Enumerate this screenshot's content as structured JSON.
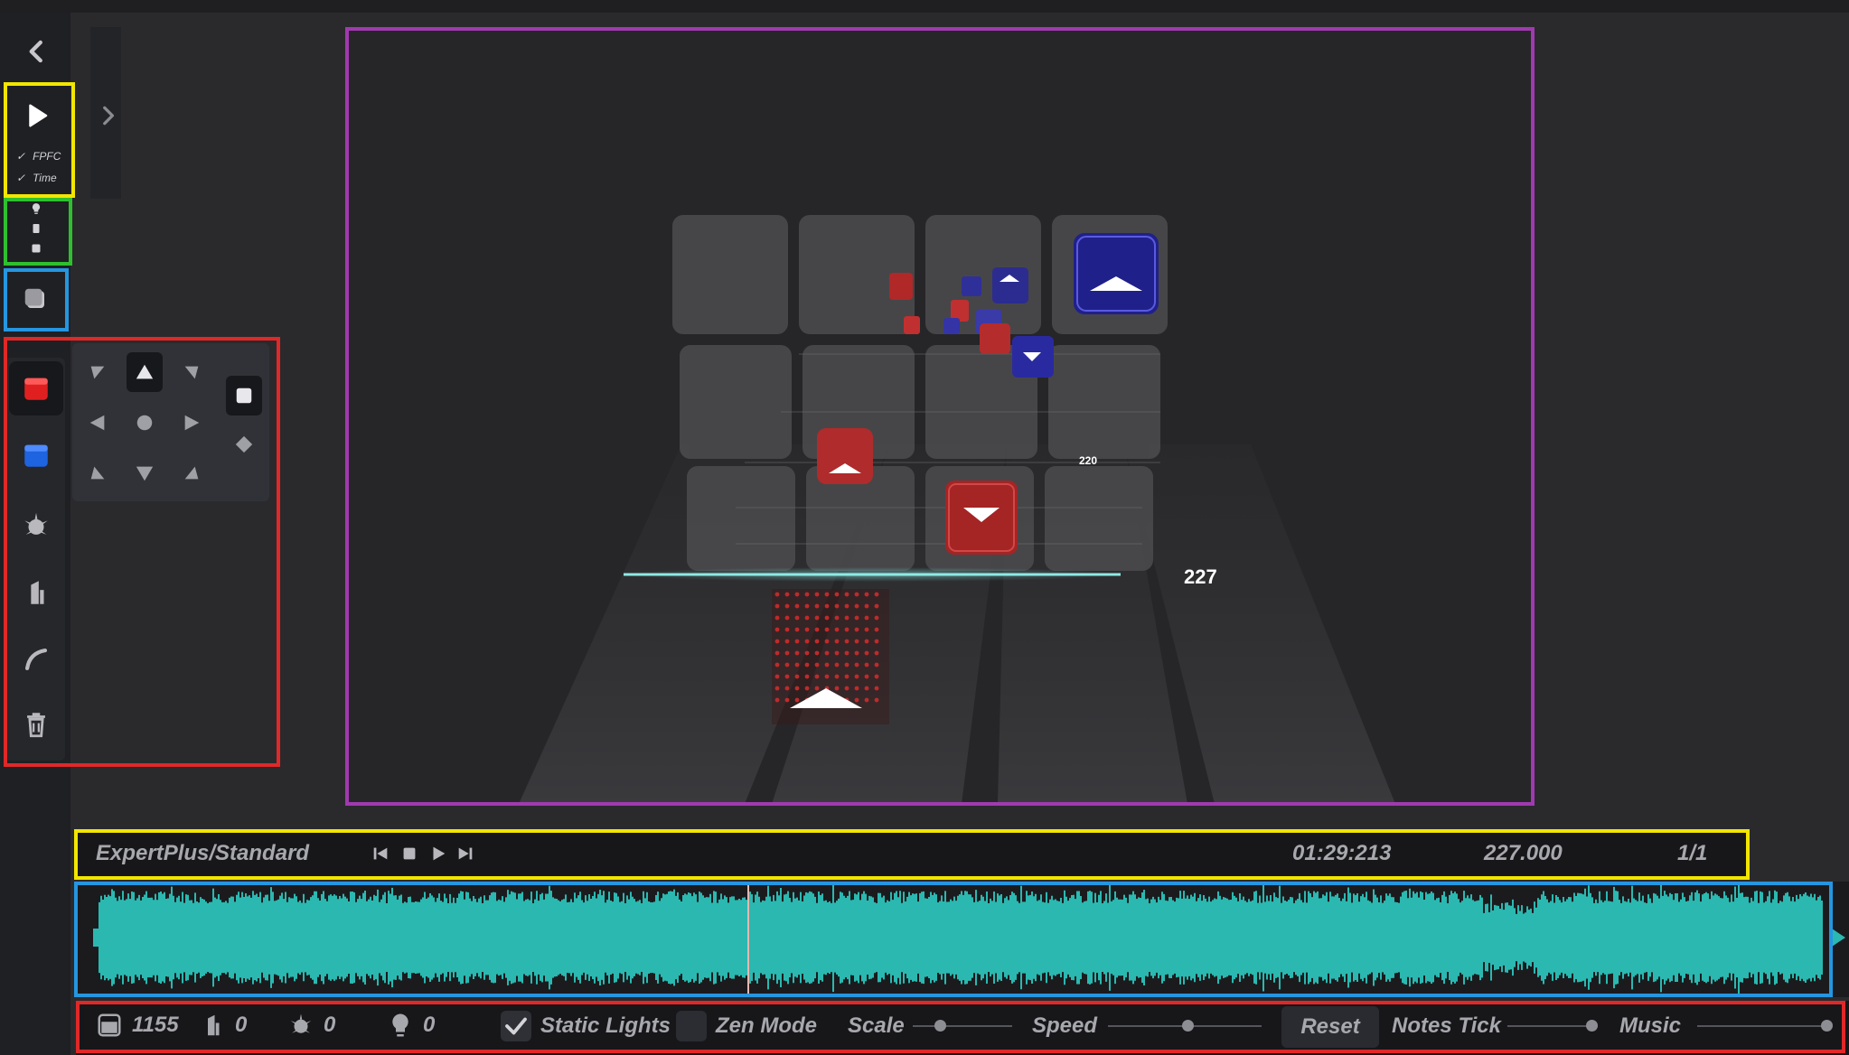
{
  "app": {
    "difficulty": "ExpertPlus/Standard",
    "time": "01:29:213",
    "beat": "227.000",
    "subdivision": "1/1"
  },
  "playback": {
    "options": [
      "FPFC",
      "Time"
    ]
  },
  "viewport": {
    "beat_labels": [
      "227",
      "220"
    ]
  },
  "stats": {
    "notes": "1155",
    "walls": "0",
    "events": "0",
    "bookmarks": "0"
  },
  "controls": {
    "static_lights": "Static Lights",
    "zen_mode": "Zen Mode",
    "scale": "Scale",
    "speed": "Speed",
    "reset": "Reset",
    "notes_tick": "Notes Tick",
    "music": "Music",
    "static_lights_checked": true,
    "zen_mode_checked": false,
    "scale_value": 0.27,
    "speed_value": 0.52,
    "notes_tick_value": 0.93,
    "music_value": 0.98
  },
  "colors": {
    "red_note": "#e02020",
    "blue_note": "#1e63e0",
    "waveform": "#2bb8b0",
    "cursor_line": "#7fe6e0",
    "panel": "#1f2024"
  },
  "icons": {
    "back": "chevron-left-icon",
    "expand": "chevron-right-icon",
    "play": "play-icon",
    "red_note_tool": "red-note-icon",
    "blue_note_tool": "blue-note-icon",
    "bomb_tool": "bomb-icon",
    "wall_tool": "wall-icon",
    "arc_tool": "arc-icon",
    "delete_tool": "trash-icon"
  }
}
